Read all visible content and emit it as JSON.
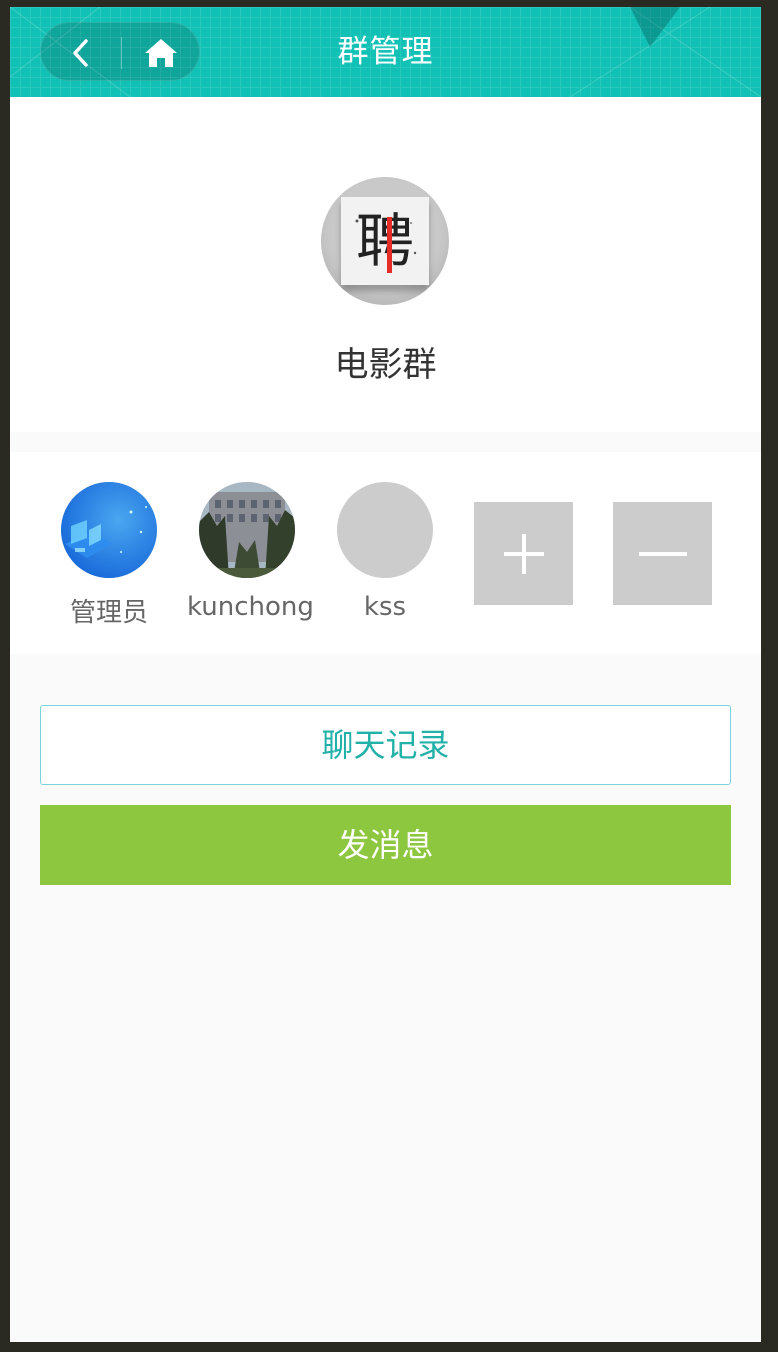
{
  "header": {
    "title": "群管理",
    "back_icon": "chevron-left-icon",
    "home_icon": "home-icon",
    "background_color": "#12c1b5"
  },
  "group": {
    "name": "电影群",
    "avatar_glyph": "聘",
    "avatar_description": "recruitment logo"
  },
  "members": [
    {
      "name": "管理员",
      "avatar": "tech-illustration-avatar"
    },
    {
      "name": "kunchong",
      "avatar": "building-photo-avatar"
    },
    {
      "name": "kss",
      "avatar": "placeholder-avatar"
    }
  ],
  "actions": {
    "add_member_icon": "plus-icon",
    "remove_member_icon": "minus-icon"
  },
  "buttons": {
    "chat_history": "聊天记录",
    "send_message": "发消息",
    "chat_history_color": "#22b1a8",
    "send_message_color": "#8dc63f"
  }
}
